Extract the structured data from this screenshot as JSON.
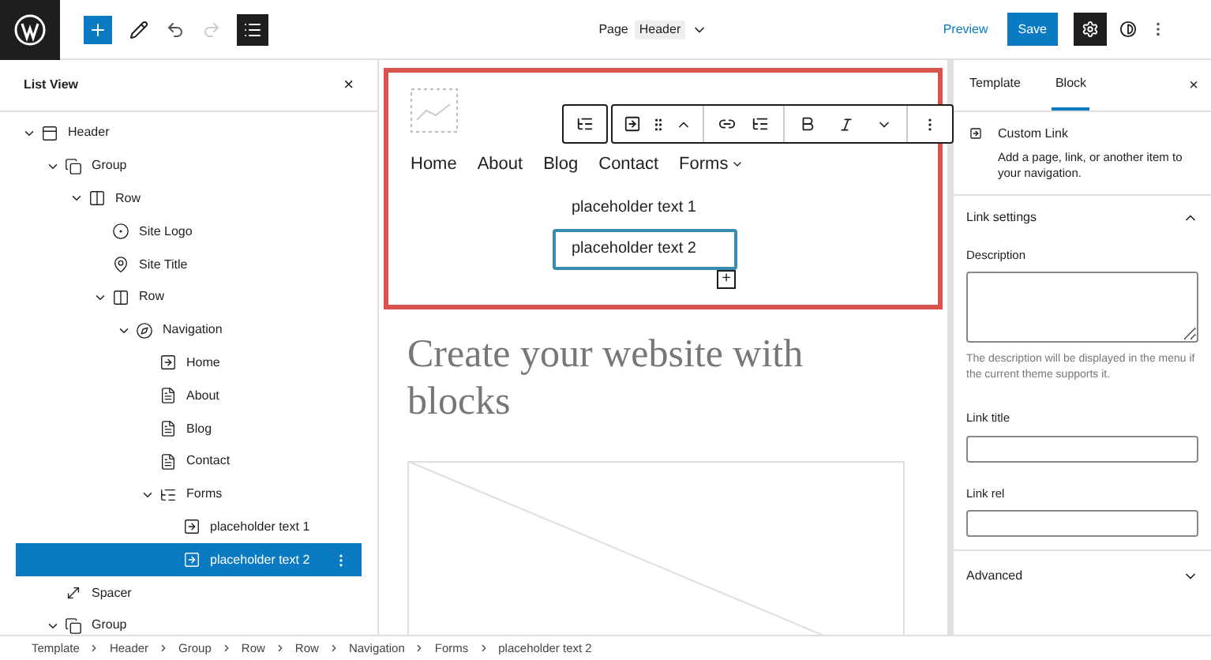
{
  "top_bar": {
    "document": {
      "type": "Page",
      "name": "Header"
    },
    "preview": "Preview",
    "save": "Save",
    "list_view_active": true,
    "settings_active": true,
    "redo_disabled": true
  },
  "list_view": {
    "title": "List View",
    "close": "×",
    "tree": [
      {
        "label": "Header",
        "kind": "header",
        "expanded": true,
        "selected": false,
        "children": [
          {
            "label": "Group",
            "kind": "group",
            "expanded": true,
            "selected": false,
            "children": [
              {
                "label": "Row",
                "kind": "row",
                "expanded": true,
                "selected": false,
                "children": [
                  {
                    "label": "Site Logo",
                    "kind": "logo",
                    "selected": false
                  },
                  {
                    "label": "Site Title",
                    "kind": "pin",
                    "selected": false
                  },
                  {
                    "label": "Row",
                    "kind": "row",
                    "expanded": true,
                    "selected": false,
                    "children": [
                      {
                        "label": "Navigation",
                        "kind": "navigation",
                        "expanded": true,
                        "selected": false,
                        "children": [
                          {
                            "label": "Home",
                            "kind": "link",
                            "selected": false
                          },
                          {
                            "label": "About",
                            "kind": "page",
                            "selected": false
                          },
                          {
                            "label": "Blog",
                            "kind": "page",
                            "selected": false
                          },
                          {
                            "label": "Contact",
                            "kind": "page",
                            "selected": false
                          },
                          {
                            "label": "Forms",
                            "kind": "submenu",
                            "expanded": true,
                            "selected": false,
                            "children": [
                              {
                                "label": "placeholder text 1",
                                "kind": "link",
                                "selected": false
                              },
                              {
                                "label": "placeholder text 2",
                                "kind": "link",
                                "selected": true
                              }
                            ]
                          }
                        ]
                      }
                    ]
                  }
                ]
              }
            ]
          },
          {
            "label": "Spacer",
            "kind": "spacer",
            "selected": false
          },
          {
            "label": "Group",
            "kind": "group",
            "expanded": true,
            "selected": false
          }
        ]
      }
    ]
  },
  "canvas": {
    "nav": [
      "Home",
      "About",
      "Blog",
      "Contact",
      "Forms"
    ],
    "submenu": [
      {
        "label": "placeholder text 1",
        "selected": false
      },
      {
        "label": "placeholder text 2",
        "selected": true
      }
    ],
    "add": "+",
    "heading": "Create your website with blocks"
  },
  "sidebar": {
    "tabs": [
      {
        "label": "Template",
        "selected": false
      },
      {
        "label": "Block",
        "selected": true
      }
    ],
    "close": "×",
    "block": {
      "title": "Custom Link",
      "description": "Add a page, link, or another item to your navigation."
    },
    "panels": [
      {
        "title": "Link settings",
        "expanded": true
      },
      {
        "title": "Advanced",
        "expanded": false
      }
    ],
    "description_label": "Description",
    "help": "The description will be displayed in the menu if the current theme supports it.",
    "link_title_label": "Link title",
    "link_rel_label": "Link rel"
  },
  "breadcrumbs": [
    "Template",
    "Header",
    "Group",
    "Row",
    "Row",
    "Navigation",
    "Forms",
    "placeholder text 2"
  ]
}
